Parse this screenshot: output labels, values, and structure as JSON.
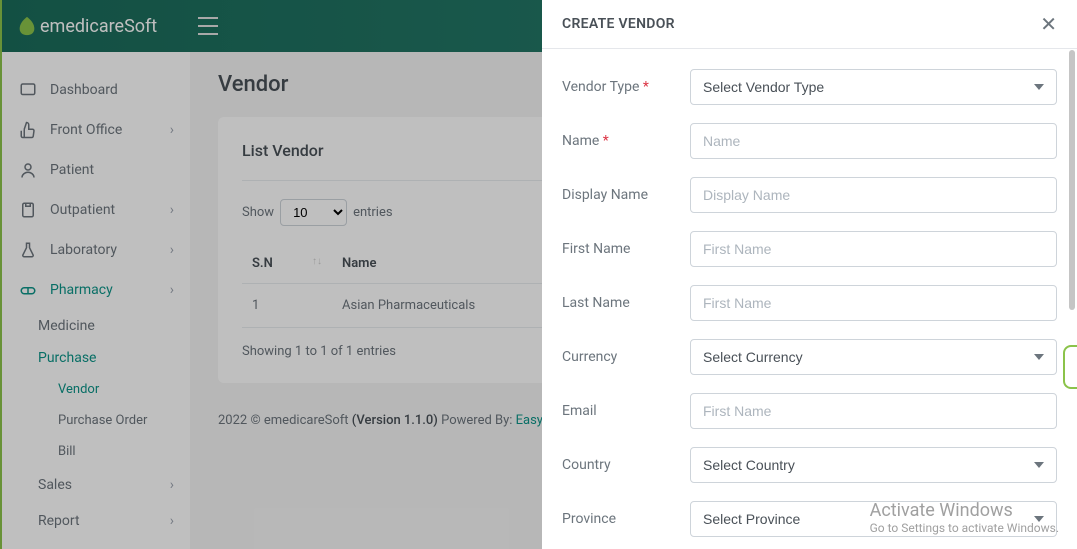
{
  "brand": {
    "name": "emedicareSoft"
  },
  "sidebar": {
    "items": [
      {
        "label": "Dashboard"
      },
      {
        "label": "Front Office"
      },
      {
        "label": "Patient"
      },
      {
        "label": "Outpatient"
      },
      {
        "label": "Laboratory"
      },
      {
        "label": "Pharmacy"
      }
    ],
    "pharmacy_children": [
      {
        "label": "Medicine"
      },
      {
        "label": "Purchase"
      }
    ],
    "purchase_children": [
      {
        "label": "Vendor"
      },
      {
        "label": "Purchase Order"
      },
      {
        "label": "Bill"
      }
    ],
    "tail": [
      {
        "label": "Sales"
      },
      {
        "label": "Report"
      }
    ]
  },
  "page": {
    "title": "Vendor",
    "card_title": "List Vendor",
    "show_label": "Show",
    "entries_label": "entries",
    "page_size": "10",
    "columns": {
      "sn": "S.N",
      "name": "Name"
    },
    "rows": [
      {
        "sn": "1",
        "name": "Asian Pharmaceuticals"
      }
    ],
    "info": "Showing 1 to 1 of 1 entries"
  },
  "footer": {
    "copyright": "2022 © emedicareSoft ",
    "version": "(Version 1.1.0)",
    "powered": " Powered By: ",
    "link": "Easy Access (P"
  },
  "panel": {
    "title": "CREATE VENDOR",
    "fields": {
      "vendor_type": {
        "label": "Vendor Type ",
        "select": "Select Vendor Type"
      },
      "name": {
        "label": "Name ",
        "placeholder": "Name"
      },
      "display_name": {
        "label": "Display Name",
        "placeholder": "Display Name"
      },
      "first_name": {
        "label": "First Name",
        "placeholder": "First Name"
      },
      "last_name": {
        "label": "Last Name",
        "placeholder": "First Name"
      },
      "currency": {
        "label": "Currency",
        "select": "Select Currency"
      },
      "email": {
        "label": "Email",
        "placeholder": "First Name"
      },
      "country": {
        "label": "Country",
        "select": "Select Country"
      },
      "province": {
        "label": "Province",
        "select": "Select Province"
      }
    }
  },
  "watermark": {
    "line1": "Activate Windows",
    "line2": "Go to Settings to activate Windows."
  }
}
